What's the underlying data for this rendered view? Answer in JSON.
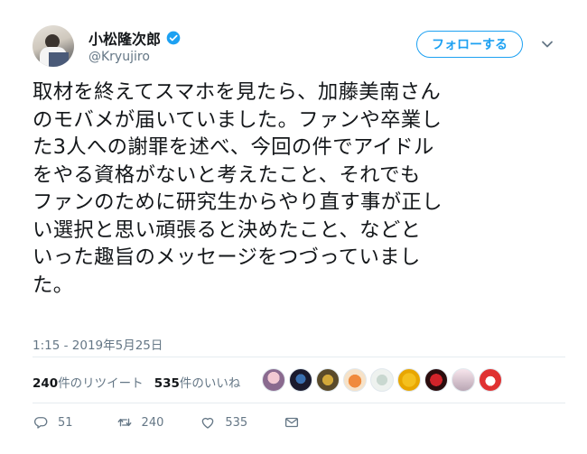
{
  "user": {
    "display_name": "小松隆次郎",
    "handle": "@Kryujiro",
    "verified_icon": "verified-badge-icon"
  },
  "follow_label": "フォローする",
  "tweet": {
    "lines": [
      "取材を終えてスマホを見たら、加藤美南さん",
      "のモバメが届いていました。ファンや卒業し",
      "た3人への謝罪を述べ、今回の件でアイドル",
      "をやる資格がないと考えたこと、それでも",
      "ファンのために研究生からやり直す事が正し",
      "い選択と思い頑張ると決めたこと、などと",
      "いった趣旨のメッセージをつづっていまし",
      "た。"
    ],
    "timestamp": "1:15 - 2019年5月25日"
  },
  "stats": {
    "retweets_count": "240",
    "retweets_label": "件のリツイート",
    "likes_count": "535",
    "likes_label": "件のいいね"
  },
  "actions": {
    "reply_count": "51",
    "retweet_count": "240",
    "like_count": "535"
  },
  "colors": {
    "accent": "#1da1f2",
    "text": "#14171a",
    "secondary": "#657786",
    "divider": "#e6ecf0"
  }
}
